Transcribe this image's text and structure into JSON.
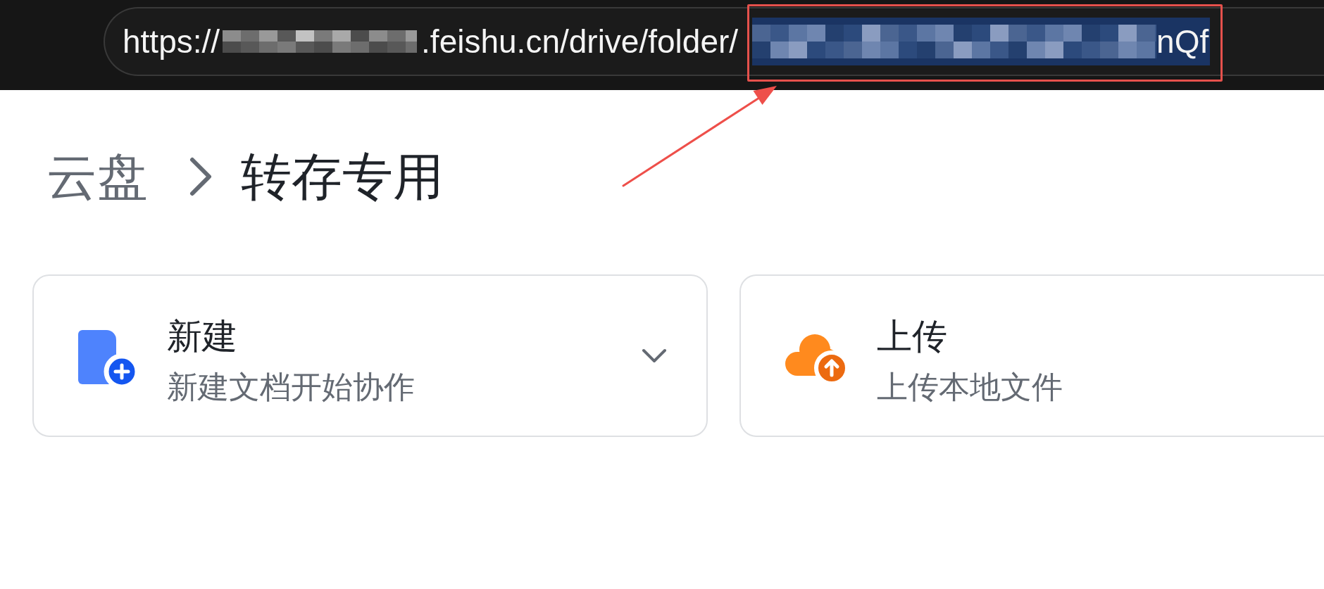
{
  "address_bar": {
    "url_parts": [
      {
        "kind": "text",
        "text": "https://",
        "selected": false
      },
      {
        "kind": "redacted",
        "selected": false
      },
      {
        "kind": "text",
        "text": ".feishu.cn/drive/folder/",
        "selected": false
      },
      {
        "kind": "redacted",
        "selected": true
      },
      {
        "kind": "text",
        "text": "nQf",
        "selected": true
      }
    ]
  },
  "annotation": {
    "highlight_box": true,
    "arrow": true
  },
  "breadcrumb": [
    {
      "text": "云盘",
      "current": false
    },
    {
      "text": "转存专用",
      "current": true
    }
  ],
  "action_cards": [
    {
      "kind": "new",
      "title": "新建",
      "subtitle": "新建文档开始协作",
      "dropdown": true
    },
    {
      "kind": "upload",
      "title": "上传",
      "subtitle": "上传本地文件",
      "dropdown": false
    }
  ]
}
